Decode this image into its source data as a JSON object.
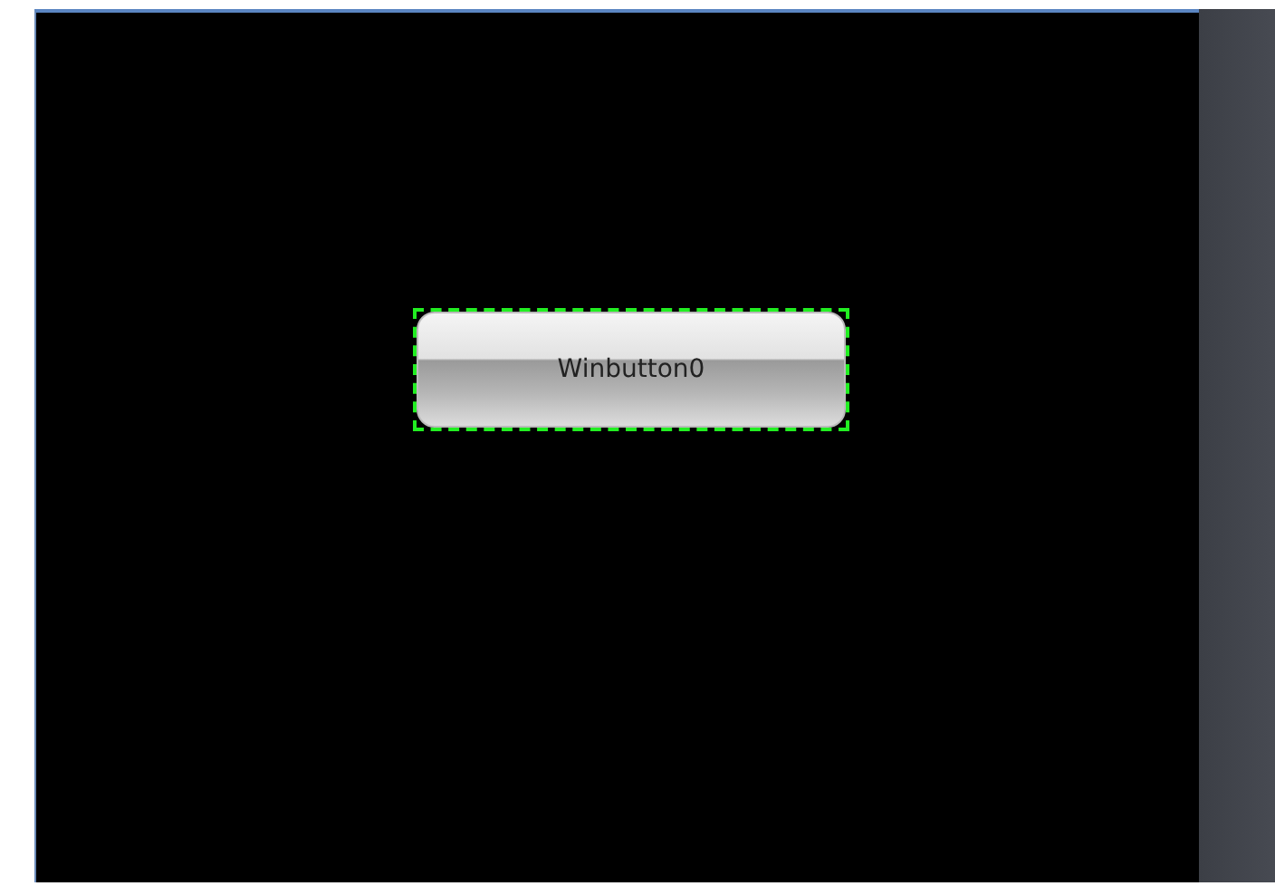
{
  "canvas": {
    "button": {
      "label": "Winbutton0",
      "selected": true
    }
  }
}
